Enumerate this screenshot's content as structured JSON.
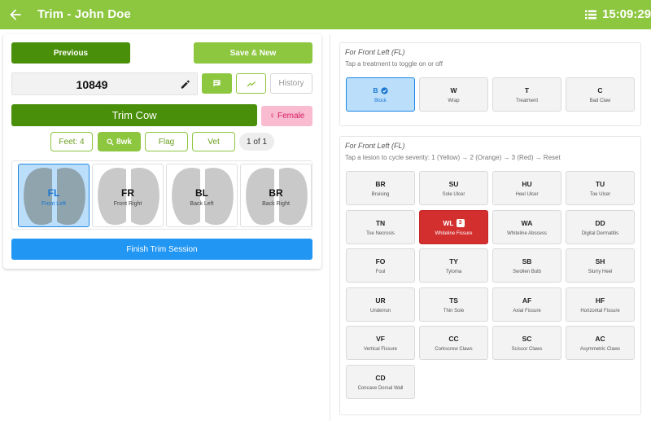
{
  "header": {
    "title": "Trim - John Doe",
    "time": "15:09:29",
    "bar_color": "#8dc63f",
    "back_icon": "arrow-left-icon",
    "menu_icon": "list-icon"
  },
  "left": {
    "previous_label": "Previous",
    "save_new_label": "Save & New",
    "cow_id": "10849",
    "history_label": "History",
    "trim_label": "Trim Cow",
    "female_label": "♀ Female",
    "feet_label": "Feet: 4",
    "wk_label": "8wk",
    "flag_label": "Flag",
    "vet_label": "Vet",
    "page_label": "1 of 1",
    "hooves": [
      {
        "code": "FL",
        "name": "Front Left",
        "selected": true
      },
      {
        "code": "FR",
        "name": "Front Right",
        "selected": false
      },
      {
        "code": "BL",
        "name": "Back Left",
        "selected": false
      },
      {
        "code": "BR",
        "name": "Back Right",
        "selected": false
      }
    ],
    "finish_label": "Finish Trim Session"
  },
  "treatments": {
    "heading": "For Front Left (FL)",
    "hint": "Tap a treatment to toggle on or off",
    "items": [
      {
        "code": "B",
        "name": "Block",
        "active": true
      },
      {
        "code": "W",
        "name": "Wrap",
        "active": false
      },
      {
        "code": "T",
        "name": "Treatment",
        "active": false
      },
      {
        "code": "C",
        "name": "Bad Claw",
        "active": false
      }
    ]
  },
  "lesions": {
    "heading": "For Front Left (FL)",
    "hint": "Tap a lesion to cycle severity: 1 (Yellow) → 2 (Orange) → 3 (Red) → Reset",
    "items": [
      {
        "code": "BR",
        "name": "Bruising",
        "severity": 0
      },
      {
        "code": "SU",
        "name": "Sole Ulcer",
        "severity": 0
      },
      {
        "code": "HU",
        "name": "Heel Ulcer",
        "severity": 0
      },
      {
        "code": "TU",
        "name": "Toe Ulcer",
        "severity": 0
      },
      {
        "code": "TN",
        "name": "Toe Necrosis",
        "severity": 0
      },
      {
        "code": "WL",
        "name": "Whiteline Fissure",
        "severity": 3
      },
      {
        "code": "WA",
        "name": "Whiteline Abscess",
        "severity": 0
      },
      {
        "code": "DD",
        "name": "Digital Dermatitis",
        "severity": 0
      },
      {
        "code": "FO",
        "name": "Foul",
        "severity": 0
      },
      {
        "code": "TY",
        "name": "Tyloma",
        "severity": 0
      },
      {
        "code": "SB",
        "name": "Swollen Bulb",
        "severity": 0
      },
      {
        "code": "SH",
        "name": "Slurry Heel",
        "severity": 0
      },
      {
        "code": "UR",
        "name": "Underrun",
        "severity": 0
      },
      {
        "code": "TS",
        "name": "Thin Sole",
        "severity": 0
      },
      {
        "code": "AF",
        "name": "Axial Fissure",
        "severity": 0
      },
      {
        "code": "HF",
        "name": "Horizontal Fissure",
        "severity": 0
      },
      {
        "code": "VF",
        "name": "Vertical Fissure",
        "severity": 0
      },
      {
        "code": "CC",
        "name": "Corkscrew Claws",
        "severity": 0
      },
      {
        "code": "SC",
        "name": "Scissor Claws",
        "severity": 0
      },
      {
        "code": "AC",
        "name": "Asymmetric Claws",
        "severity": 0
      },
      {
        "code": "CD",
        "name": "Concave Dorsal Wall",
        "severity": 0
      }
    ]
  }
}
